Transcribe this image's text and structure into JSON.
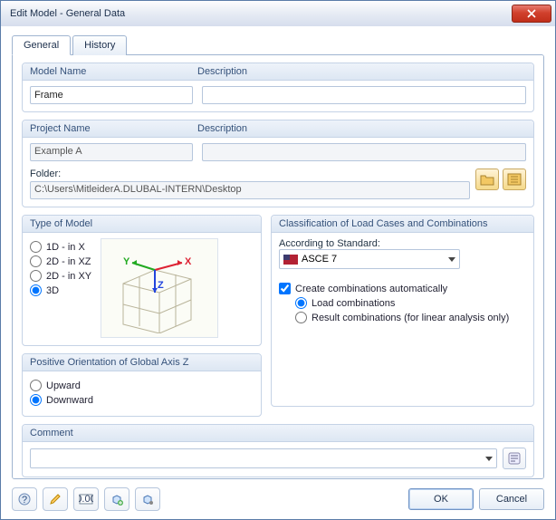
{
  "window": {
    "title": "Edit Model - General Data"
  },
  "tabs": {
    "general": "General",
    "history": "History"
  },
  "group_labels": {
    "model_name": "Model Name",
    "description": "Description",
    "project_name": "Project Name",
    "folder": "Folder:",
    "type_of_model": "Type of Model",
    "classification": "Classification of Load Cases and Combinations",
    "positive_orientation": "Positive Orientation of Global Axis Z",
    "comment": "Comment",
    "according_to_standard": "According to Standard:"
  },
  "fields": {
    "model_name": "Frame",
    "model_description": "",
    "project_name": "Example A",
    "project_description": "",
    "folder_path": "C:\\Users\\MitleiderA.DLUBAL-INTERN\\Desktop",
    "standard": "ASCE 7",
    "comment_value": ""
  },
  "type_of_model": {
    "options": [
      "1D - in X",
      "2D - in XZ",
      "2D - in XY",
      "3D"
    ],
    "selected": "3D"
  },
  "classification": {
    "create_auto_label": "Create combinations automatically",
    "create_auto_checked": true,
    "sub": {
      "options": [
        "Load combinations",
        "Result combinations (for linear analysis only)"
      ],
      "selected": "Load combinations"
    }
  },
  "orientation": {
    "options": [
      "Upward",
      "Downward"
    ],
    "selected": "Downward"
  },
  "buttons": {
    "ok": "OK",
    "cancel": "Cancel"
  },
  "axes": {
    "x": "X",
    "y": "Y",
    "z": "Z"
  }
}
